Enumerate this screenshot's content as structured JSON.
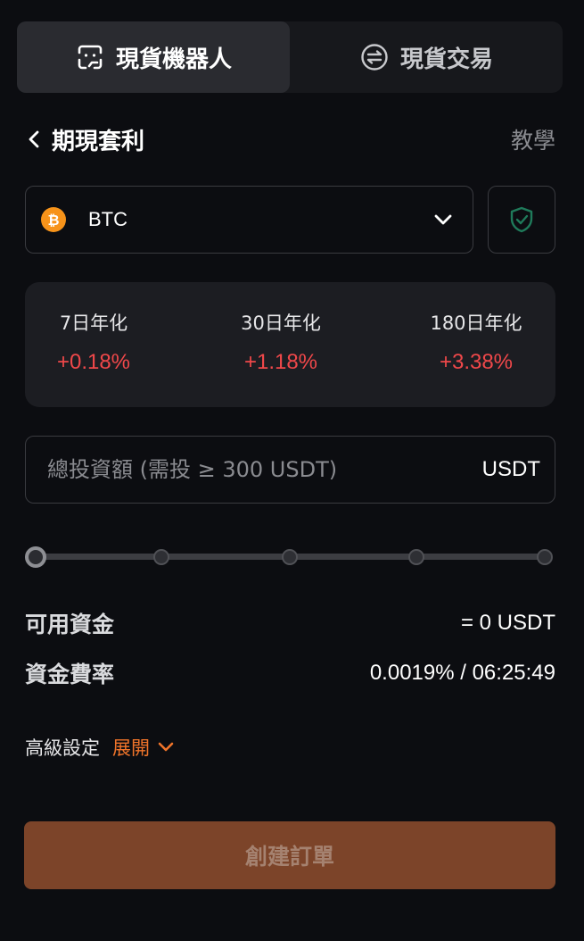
{
  "tabs": [
    {
      "label": "現貨機器人",
      "icon": "bot-icon",
      "active": true
    },
    {
      "label": "現貨交易",
      "icon": "swap-icon",
      "active": false
    }
  ],
  "header": {
    "title": "期現套利",
    "tutorial": "教學"
  },
  "coin": {
    "symbol": "BTC",
    "icon": "bitcoin-icon",
    "icon_color": "#f7931a"
  },
  "stats": [
    {
      "label": "7日年化",
      "value": "+0.18%"
    },
    {
      "label": "30日年化",
      "value": "+1.18%"
    },
    {
      "label": "180日年化",
      "value": "+3.38%"
    }
  ],
  "amount": {
    "placeholder": "總投資額 (需投 ≥ 300 USDT)",
    "value": "",
    "unit": "USDT"
  },
  "slider": {
    "stops": 5,
    "value_fraction": 0
  },
  "available": {
    "label": "可用資金",
    "value": "= 0 USDT"
  },
  "funding": {
    "label": "資金費率",
    "value": "0.0019% / 06:25:49"
  },
  "advanced": {
    "label": "高級設定",
    "toggle": "展開"
  },
  "create_button": {
    "label": "創建訂單"
  },
  "colors": {
    "accent": "#f0742a",
    "positive": "#f0484a",
    "button_bg": "#7c4429",
    "shield": "#1f7a5a"
  }
}
